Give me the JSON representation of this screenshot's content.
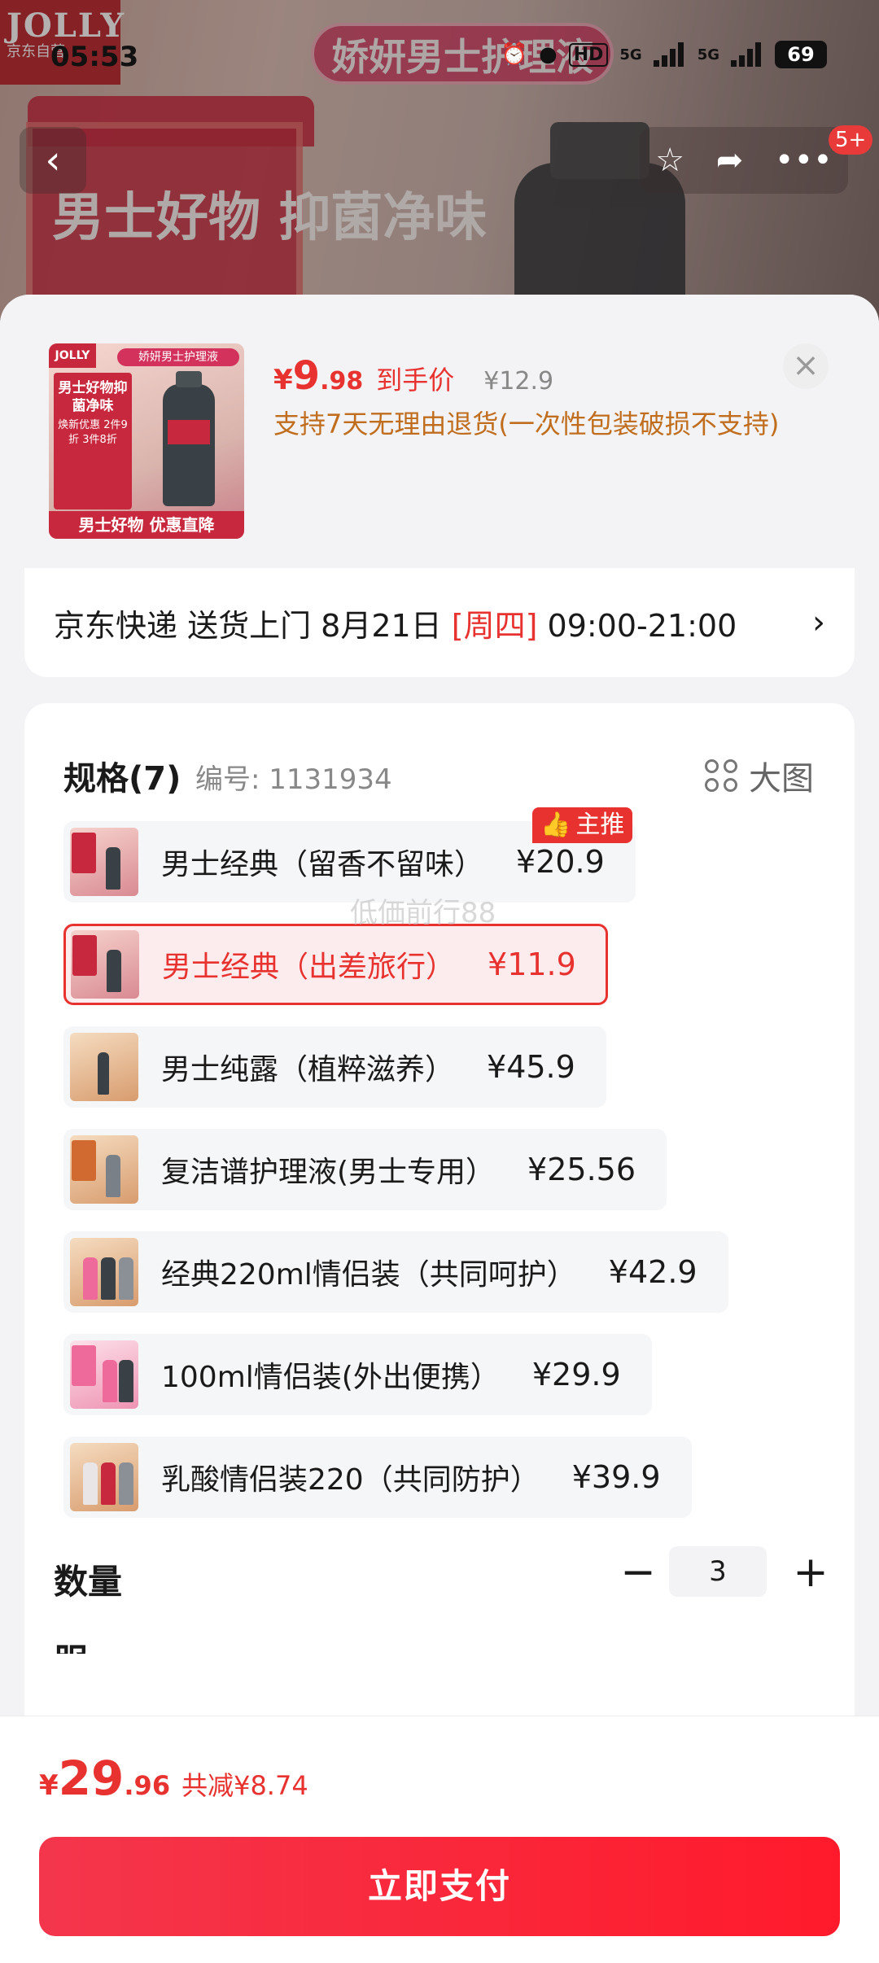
{
  "status_bar": {
    "time": "05:53",
    "network_1": "5G",
    "network_2": "5G",
    "hd": "HD",
    "battery": "69"
  },
  "backdrop": {
    "logo_text": "JOLLY",
    "logo_sub": "京东自营",
    "banner": "娇妍男士护理液",
    "promo_text": "男士好物 抑菌净味"
  },
  "nav": {
    "back_icon": "‹",
    "notification_badge": "5+"
  },
  "product": {
    "thumb": {
      "tag": "娇妍男士护理液",
      "logo": "JOLLY",
      "box_text": "男士好物抑菌净味",
      "box_sub": "焕新优惠 2件9折 3件8折",
      "footer": "男士好物 优惠直降"
    },
    "price_symbol": "¥",
    "price_int": "9",
    "price_dec": ".98",
    "price_label": "到手价",
    "original_price": "¥12.9",
    "return_policy": "支持7天无理由退货(一次性包装破损不支持)"
  },
  "delivery": {
    "text_before": "京东快递 送货上门 8月21日 ",
    "weekday": "[周四]",
    "text_after": " 09:00-21:00",
    "chevron": "›"
  },
  "specs": {
    "title": "规格(7)",
    "code": "编号: 1131934",
    "big_image_label": "大图",
    "recommended_tag": "主推",
    "watermark": "低価前行88",
    "options": [
      {
        "name": "男士经典（留香不留味）",
        "price": "¥20.9"
      },
      {
        "name": "男士经典（出差旅行）",
        "price": "¥11.9"
      },
      {
        "name": "男士纯露（植粹滋养）",
        "price": "¥45.9"
      },
      {
        "name": "复洁谱护理液(男士专用）",
        "price": "¥25.56"
      },
      {
        "name": "经典220ml情侣装（共同呵护）",
        "price": "¥42.9"
      },
      {
        "name": "100ml情侣装(外出便携）",
        "price": "¥29.9"
      },
      {
        "name": "乳酸情侣装220（共同防护）",
        "price": "¥39.9"
      }
    ],
    "selected_index": 1
  },
  "quantity": {
    "label": "数量",
    "minus": "−",
    "value": "3",
    "plus": "+"
  },
  "service_peek": "服务",
  "footer": {
    "yen": "¥",
    "total_int": "29",
    "total_dec": ".96",
    "saving": "共减¥8.74",
    "pay_button": "立即支付"
  },
  "colors": {
    "accent": "#e8322f",
    "policy": "#c06d1e"
  }
}
